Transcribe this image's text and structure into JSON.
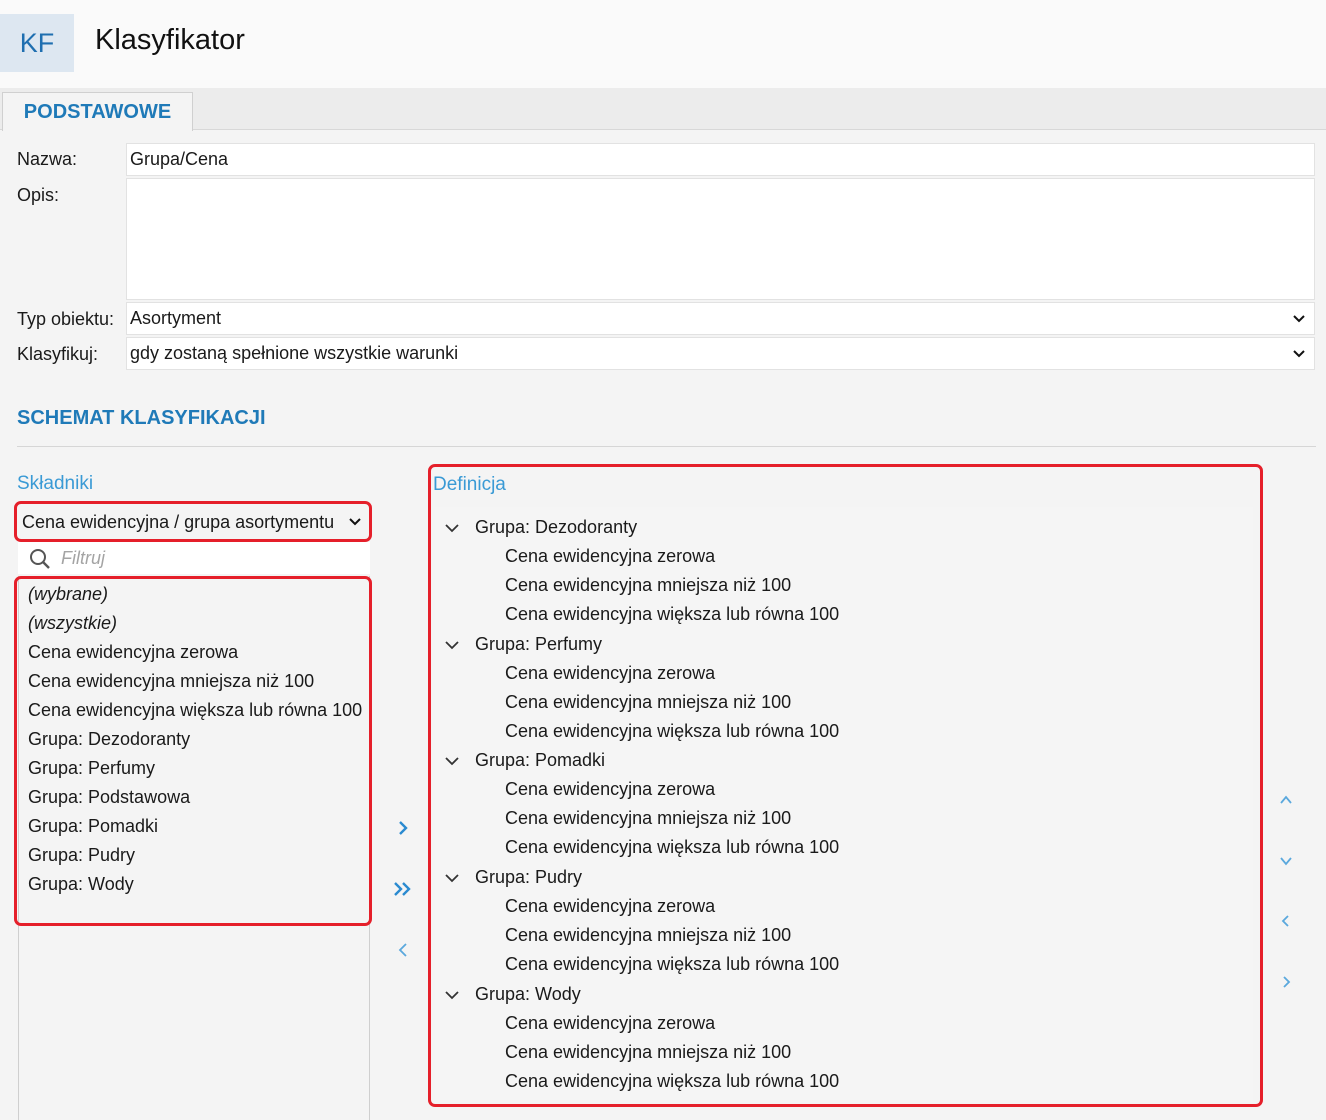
{
  "app": {
    "badge": "KF",
    "title": "Klasyfikator"
  },
  "tabs": [
    {
      "label": "PODSTAWOWE"
    }
  ],
  "form": {
    "nazwa_label": "Nazwa:",
    "nazwa_value": "Grupa/Cena",
    "opis_label": "Opis:",
    "opis_value": "",
    "typ_label": "Typ obiektu:",
    "typ_value": "Asortyment",
    "klasyfikuj_label": "Klasyfikuj:",
    "klasyfikuj_value": "gdy zostaną spełnione wszystkie warunki"
  },
  "schema": {
    "title": "SCHEMAT KLASYFIKACJI",
    "components_label": "Składniki",
    "components_dropdown": "Cena ewidencyjna / grupa asortymentu",
    "filter_placeholder": "Filtruj",
    "components": [
      "(wybrane)",
      "(wszystkie)",
      "Cena ewidencyjna zerowa",
      "Cena ewidencyjna mniejsza niż 100",
      "Cena ewidencyjna większa lub równa 100",
      "Grupa: Dezodoranty",
      "Grupa: Perfumy",
      "Grupa: Podstawowa",
      "Grupa: Pomadki",
      "Grupa: Pudry",
      "Grupa: Wody"
    ],
    "definition_label": "Definicja",
    "definition": [
      {
        "group": "Grupa: Dezodoranty",
        "items": [
          "Cena ewidencyjna zerowa",
          "Cena ewidencyjna mniejsza niż 100",
          "Cena ewidencyjna większa lub równa 100"
        ]
      },
      {
        "group": "Grupa: Perfumy",
        "items": [
          "Cena ewidencyjna zerowa",
          "Cena ewidencyjna mniejsza niż 100",
          "Cena ewidencyjna większa lub równa 100"
        ]
      },
      {
        "group": "Grupa: Pomadki",
        "items": [
          "Cena ewidencyjna zerowa",
          "Cena ewidencyjna mniejsza niż 100",
          "Cena ewidencyjna większa lub równa 100"
        ]
      },
      {
        "group": "Grupa: Pudry",
        "items": [
          "Cena ewidencyjna zerowa",
          "Cena ewidencyjna mniejsza niż 100",
          "Cena ewidencyjna większa lub równa 100"
        ]
      },
      {
        "group": "Grupa: Wody",
        "items": [
          "Cena ewidencyjna zerowa",
          "Cena ewidencyjna mniejsza niż 100",
          "Cena ewidencyjna większa lub równa 100"
        ]
      }
    ]
  },
  "icons": {
    "add": "chevron-right-icon",
    "add_all": "double-chevron-right-icon",
    "remove": "chevron-left-icon",
    "move_up": "chevron-up-icon",
    "move_down": "chevron-down-icon",
    "outdent": "chevron-left-icon",
    "indent": "chevron-right-icon"
  },
  "colors": {
    "accent": "#1f7ab8",
    "highlight_border": "#e51f2a",
    "badge_bg": "#dde7f1"
  }
}
